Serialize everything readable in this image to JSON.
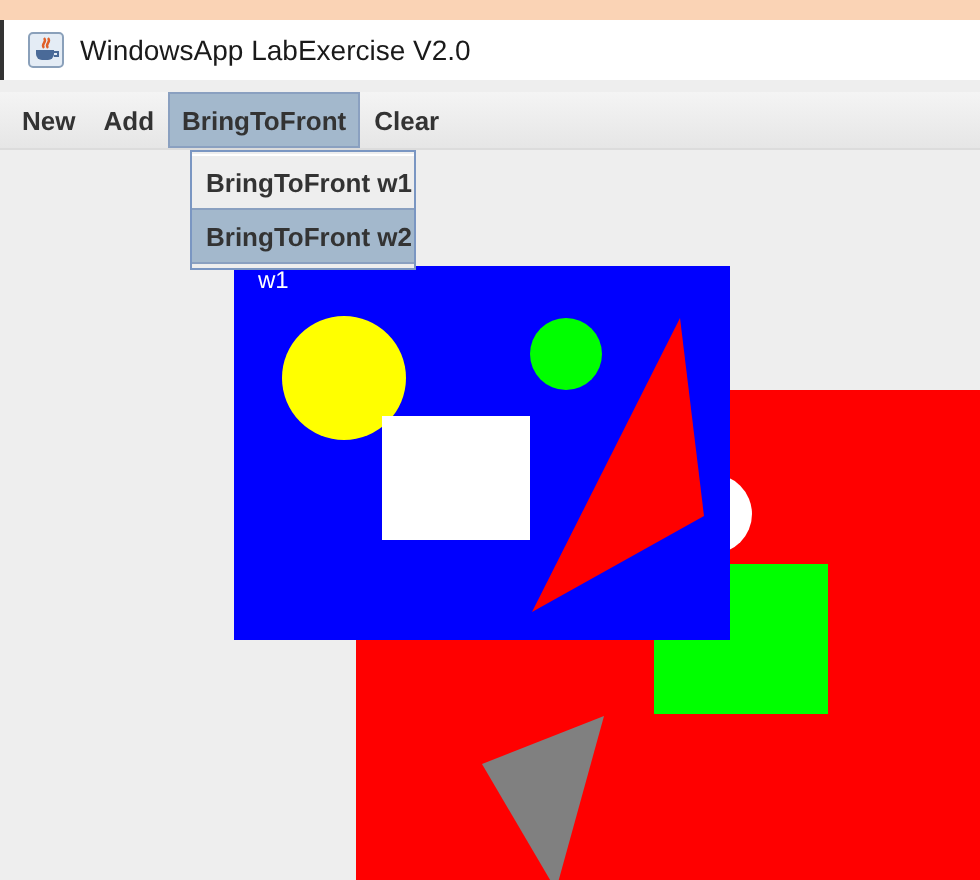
{
  "window": {
    "title": "WindowsApp LabExercise V2.0"
  },
  "menu": [
    {
      "label": "New",
      "selected": false
    },
    {
      "label": "Add",
      "selected": false
    },
    {
      "label": "BringToFront",
      "selected": true
    },
    {
      "label": "Clear",
      "selected": false
    }
  ],
  "dropdown": [
    {
      "label": "BringToFront w1",
      "selected": false
    },
    {
      "label": "BringToFront w2",
      "selected": true
    }
  ],
  "canvas_windows": [
    {
      "label": "w1",
      "color": "#0000ff"
    },
    {
      "color": "#ff0000"
    }
  ]
}
